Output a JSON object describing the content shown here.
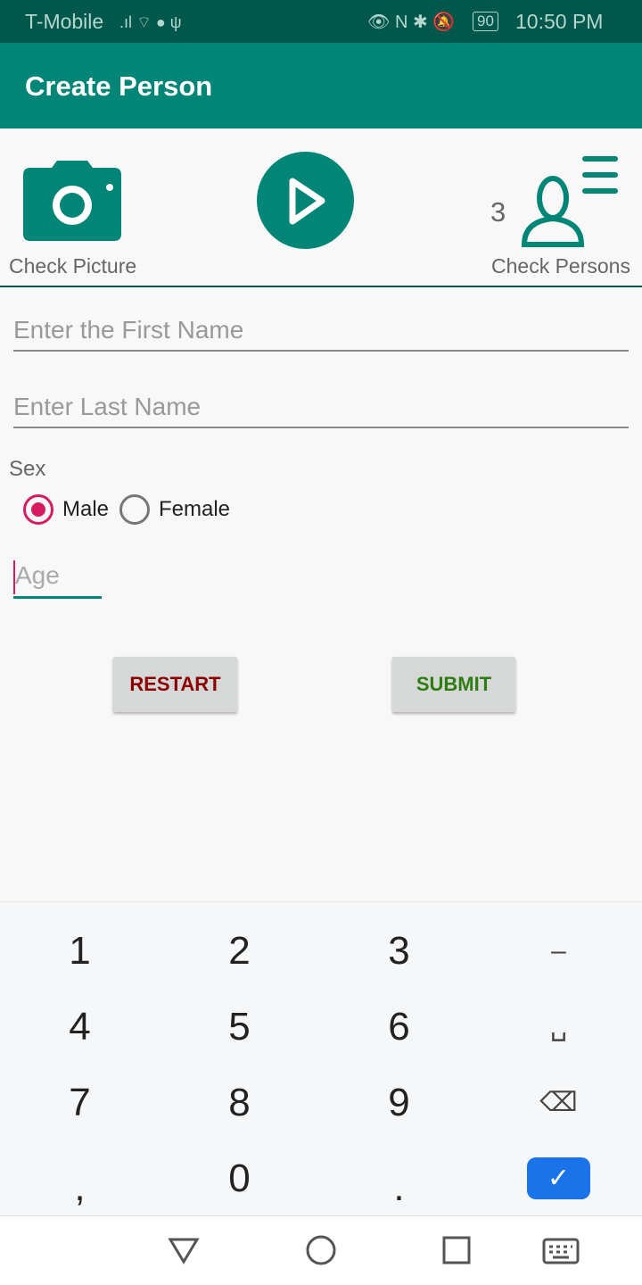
{
  "status": {
    "carrier": "T-Mobile",
    "battery": "90",
    "time": "10:50 PM"
  },
  "appbar": {
    "title": "Create Person"
  },
  "toolbar": {
    "check_picture": "Check Picture",
    "person_count": "3",
    "check_persons": "Check Persons"
  },
  "form": {
    "first_name_placeholder": "Enter the First Name",
    "last_name_placeholder": "Enter Last Name",
    "sex_label": "Sex",
    "male": "Male",
    "female": "Female",
    "selected_sex": "Male",
    "age_placeholder": "Age"
  },
  "buttons": {
    "restart": "RESTART",
    "submit": "SUBMIT",
    "restart_color": "#8b0000",
    "submit_color": "#2e7d12"
  },
  "keyboard": {
    "keys": [
      "1",
      "2",
      "3",
      "–",
      "4",
      "5",
      "6",
      "␣",
      "7",
      "8",
      "9",
      "⌫",
      ",",
      "0",
      ".",
      "✓"
    ]
  },
  "colors": {
    "accent": "#008577",
    "dark": "#00574b",
    "radio": "#d81b60",
    "kb_done": "#1a73e8"
  }
}
